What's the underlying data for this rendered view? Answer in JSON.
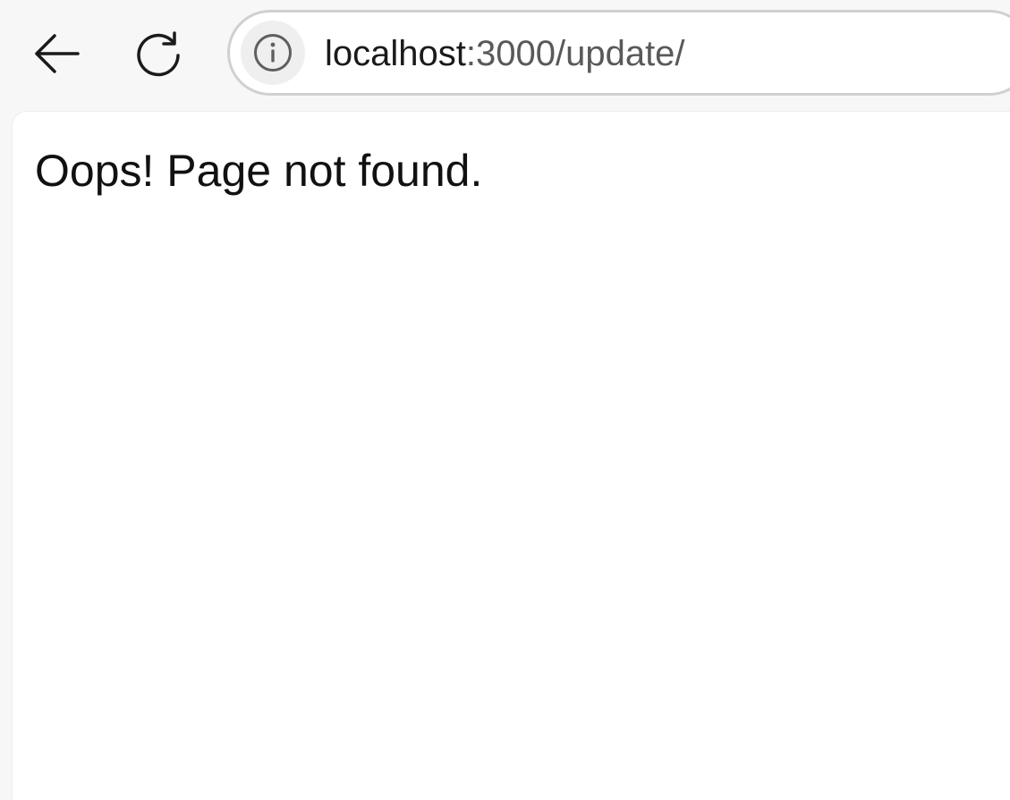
{
  "browser": {
    "back_icon": "arrow-left-icon",
    "reload_icon": "reload-icon",
    "site_info_icon": "info-icon",
    "url_host": "localhost",
    "url_rest": ":3000/update/"
  },
  "page": {
    "message": "Oops! Page not found."
  },
  "colors": {
    "toolbar_bg": "#f7f7f7",
    "page_bg": "#ffffff",
    "url_host": "#1a1a1a",
    "url_path": "#595959"
  }
}
